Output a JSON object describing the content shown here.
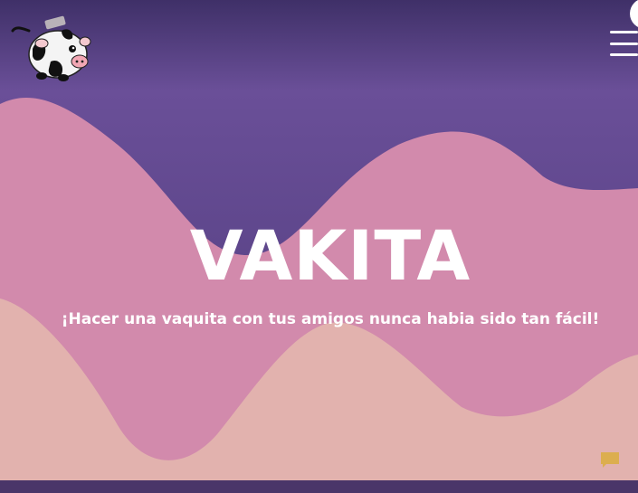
{
  "hero": {
    "title": "VAKITA",
    "subtitle": "¡Hacer una vaquita con tus amigos nunca habia sido tan fácil!"
  },
  "navbar": {
    "logo": "cow-piggy-bank-logo",
    "menu_icon": "hamburger-menu-icon"
  },
  "chat": {
    "icon": "chat-bubble-icon"
  },
  "colors": {
    "nav_top": "#3f3068",
    "nav_bottom": "#6a4f98",
    "wave_purple": "#5a4589",
    "wave_pink": "#d28aac",
    "wave_peach": "#e2b2ae",
    "chat_icon": "#dcae4f",
    "footer": "#4a3669"
  }
}
